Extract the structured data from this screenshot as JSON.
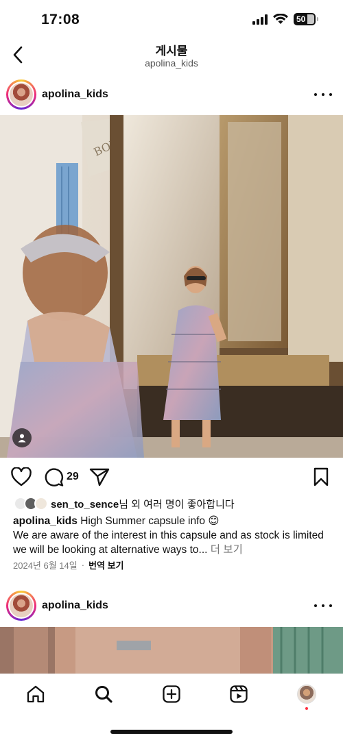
{
  "status_bar": {
    "time": "17:08",
    "battery": "50"
  },
  "nav": {
    "title": "게시물",
    "subtitle": "apolina_kids"
  },
  "posts": [
    {
      "username": "apolina_kids",
      "comment_count": "29",
      "likes": {
        "first_user": "sen_to_sence",
        "suffix": "님 외 여러 명이 좋아합니다"
      },
      "caption": {
        "username": "apolina_kids",
        "headline": "High Summer capsule info 😊",
        "body": "We are aware of the interest in this capsule and as stock is limited we will be looking at alternative ways to...",
        "more_label": "더 보기"
      },
      "date": "2024년 6월 14일",
      "separator": "·",
      "translate_label": "번역 보기"
    },
    {
      "username": "apolina_kids"
    }
  ],
  "icons": {
    "back": "chevron-left-icon",
    "more": "more-horizontal-icon",
    "like": "heart-icon",
    "comment": "comment-icon",
    "share": "send-icon",
    "save": "bookmark-icon",
    "tag": "person-icon"
  },
  "tab_bar": [
    "home",
    "search",
    "create",
    "reels",
    "profile"
  ],
  "colors": {
    "text": "#111111",
    "muted": "#777777",
    "story_ring_start": "#f9ce34",
    "story_ring_mid": "#ee2a7b",
    "notification": "#ff3040"
  }
}
